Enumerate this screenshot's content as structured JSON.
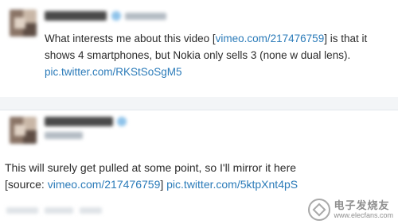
{
  "tweet1": {
    "text_before_link": "What interests me about this video [",
    "link_vimeo": "vimeo.com/217476759",
    "text_after_link": "] is that it shows 4 smartphones, but Nokia only sells 3 (none w dual lens). ",
    "link_pic": "pic.twitter.com/RKStSoSgM5"
  },
  "tweet2": {
    "text_line1": "This will surely get pulled at some point, so I'll mirror it here",
    "text_source_open": "[source: ",
    "link_vimeo": "vimeo.com/217476759",
    "text_source_close": "] ",
    "link_pic": "pic.twitter.com/5ktpXnt4pS"
  },
  "watermark": {
    "brand": "电子发烧友",
    "url": "www.elecfans.com"
  },
  "colors": {
    "link": "#2b7bb9",
    "text": "#2b2b2b",
    "divider": "#e3e8ec"
  },
  "icons": {
    "verified": "verified-badge-icon",
    "watermark": "elecfans-logo-icon"
  }
}
